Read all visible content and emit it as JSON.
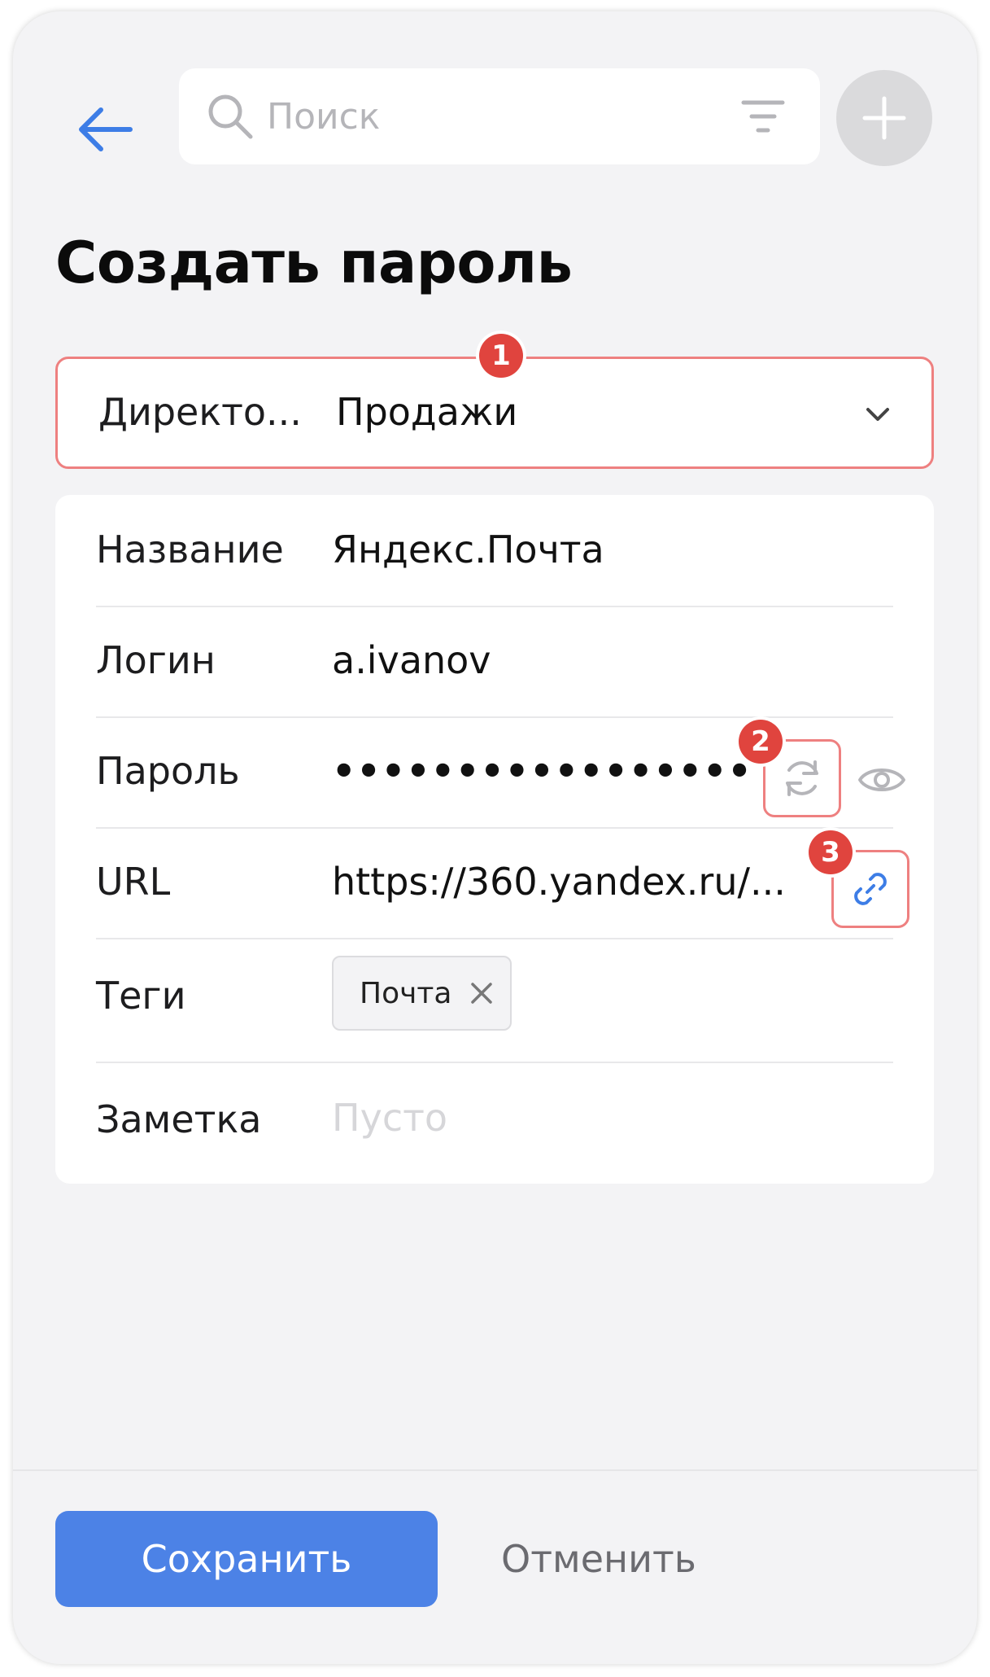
{
  "header": {
    "search_placeholder": "Поиск",
    "icons": [
      "back-arrow-icon",
      "search-icon",
      "filter-icon",
      "plus-icon"
    ]
  },
  "title": "Создать пароль",
  "directory": {
    "label": "Директо...",
    "value": "Продажи",
    "badge": "1"
  },
  "form": {
    "name": {
      "label": "Название",
      "value": "Яндекс.Почта"
    },
    "login": {
      "label": "Логин",
      "value": "a.ivanov"
    },
    "password": {
      "label": "Пароль",
      "value": "•••••••••••••••••",
      "badge": "2"
    },
    "url": {
      "label": "URL",
      "value": "https://360.yandex.ru/...",
      "badge": "3"
    },
    "tags": {
      "label": "Теги",
      "items": [
        "Почта"
      ]
    },
    "note": {
      "label": "Заметка",
      "placeholder": "Пусто"
    }
  },
  "footer": {
    "save_label": "Сохранить",
    "cancel_label": "Отменить"
  },
  "colors": {
    "accent": "#4c82e6",
    "link": "#3d7de6",
    "highlight": "#ee8080",
    "badge": "#e0443e",
    "background": "#f3f3f5"
  }
}
